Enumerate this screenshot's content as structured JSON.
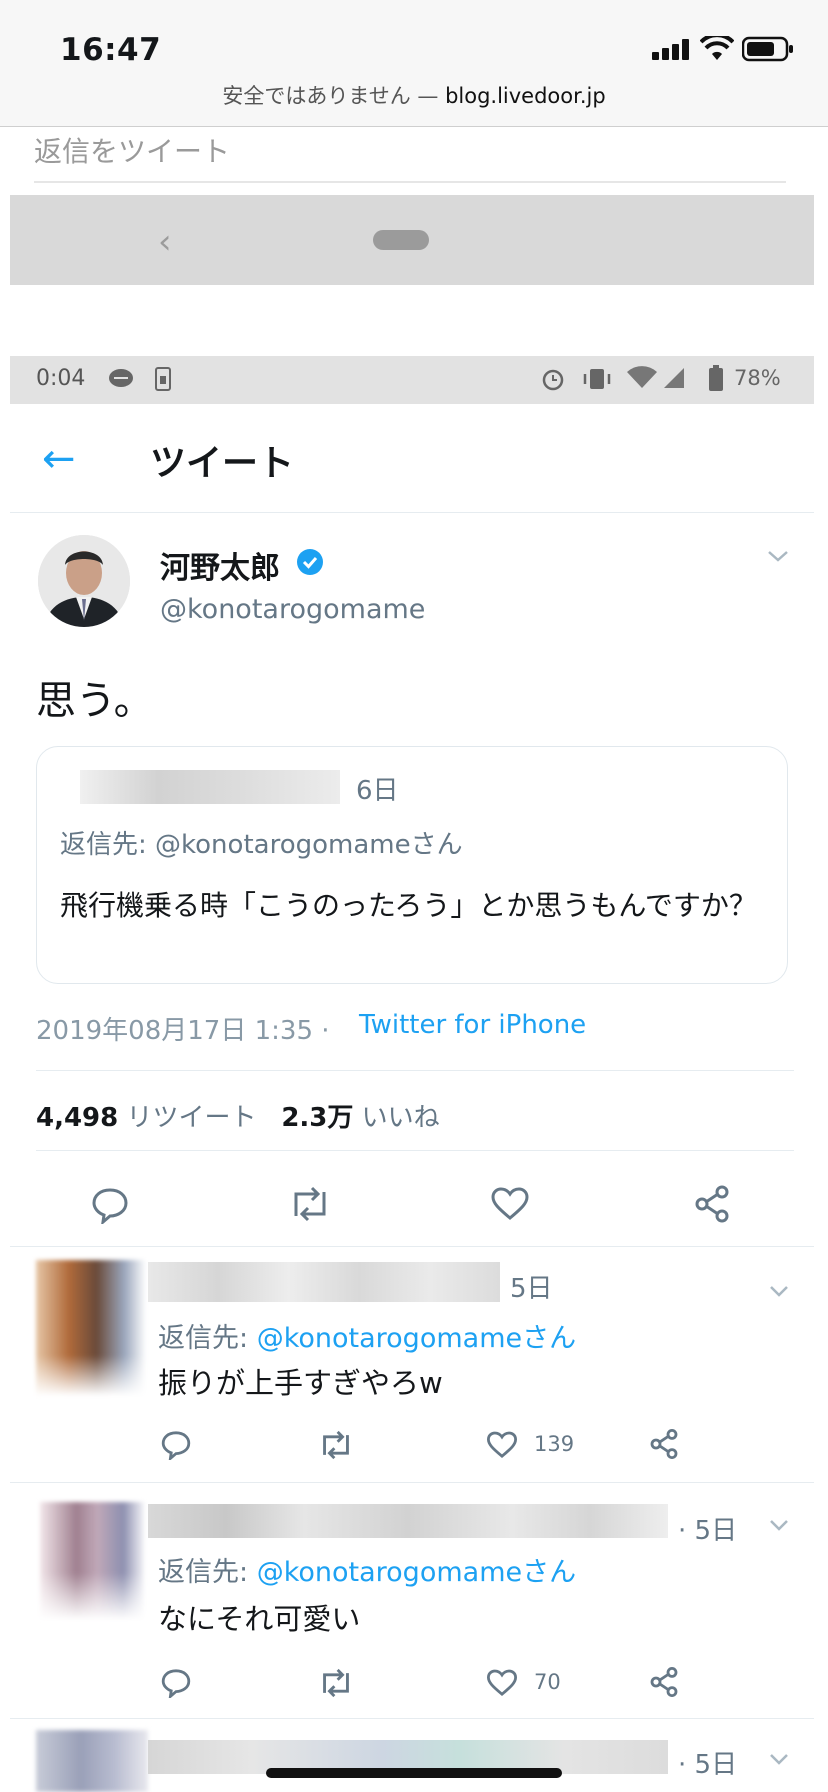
{
  "ios": {
    "time": "16:47",
    "url_prefix": "安全ではありません —",
    "url_host": "blog.livedoor.jp"
  },
  "reply_prompt": "返信をツイート",
  "android": {
    "time": "0:04",
    "battery": "78%"
  },
  "header": {
    "title": "ツイート"
  },
  "tweet": {
    "name": "河野太郎",
    "handle": "@konotarogomame",
    "body": "思う。",
    "quote": {
      "time": "6日",
      "reply_to": "返信先: @konotarogomameさん",
      "text": "飛行機乗る時「こうのったろう」とか思うもんですか？"
    },
    "timestamp": "2019年08月17日 1:35 ·",
    "via": "Twitter for iPhone",
    "retweets": "4,498",
    "retweets_label": "リツイート",
    "likes": "2.3万",
    "likes_label": "いいね"
  },
  "replies": [
    {
      "time": "5日",
      "reply_label": "返信先:",
      "reply_handle": "@konotarogomameさん",
      "text": "振りが上手すぎやろw",
      "likes": "139"
    },
    {
      "time": "· 5日",
      "reply_label": "返信先:",
      "reply_handle": "@konotarogomameさん",
      "text": "なにそれ可愛い",
      "likes": "70"
    },
    {
      "time": "· 5日"
    }
  ],
  "colors": {
    "accent": "#1da1f2",
    "muted": "#657786"
  }
}
